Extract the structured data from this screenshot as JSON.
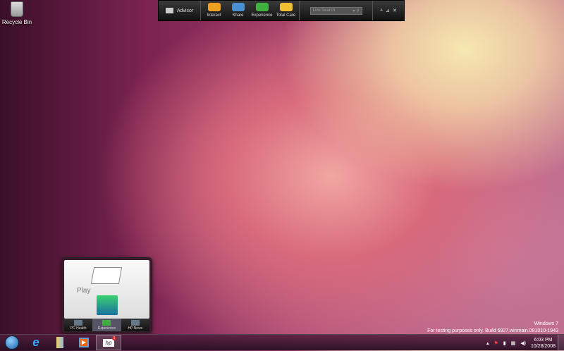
{
  "desktop": {
    "icons": [
      {
        "label": "Recycle Bin",
        "icon": "recycle-bin-icon"
      }
    ]
  },
  "toolbar": {
    "brand": "Advisor",
    "buttons": [
      {
        "label": "Interact",
        "color": "#f0a020"
      },
      {
        "label": "Share",
        "color": "#4a90d0"
      },
      {
        "label": "Experience",
        "color": "#40b040"
      },
      {
        "label": "Total Care",
        "color": "#f0c030"
      }
    ],
    "search_placeholder": "Live Search",
    "controls": [
      "minimize",
      "pin",
      "close"
    ]
  },
  "popup": {
    "title": "Play",
    "tabs": [
      {
        "label": "PC Health"
      },
      {
        "label": "Experience",
        "active": true
      },
      {
        "label": "HP News"
      }
    ]
  },
  "watermark": {
    "line1": "Windows 7",
    "line2": "For testing purposes only. Build 6927.winmain.081010-1943"
  },
  "taskbar": {
    "apps": [
      "start",
      "internet-explorer",
      "libraries",
      "media-player",
      "hp-advisor"
    ],
    "hp_badge": "1"
  },
  "tray": {
    "time": "6:03 PM",
    "date": "10/28/2008"
  }
}
